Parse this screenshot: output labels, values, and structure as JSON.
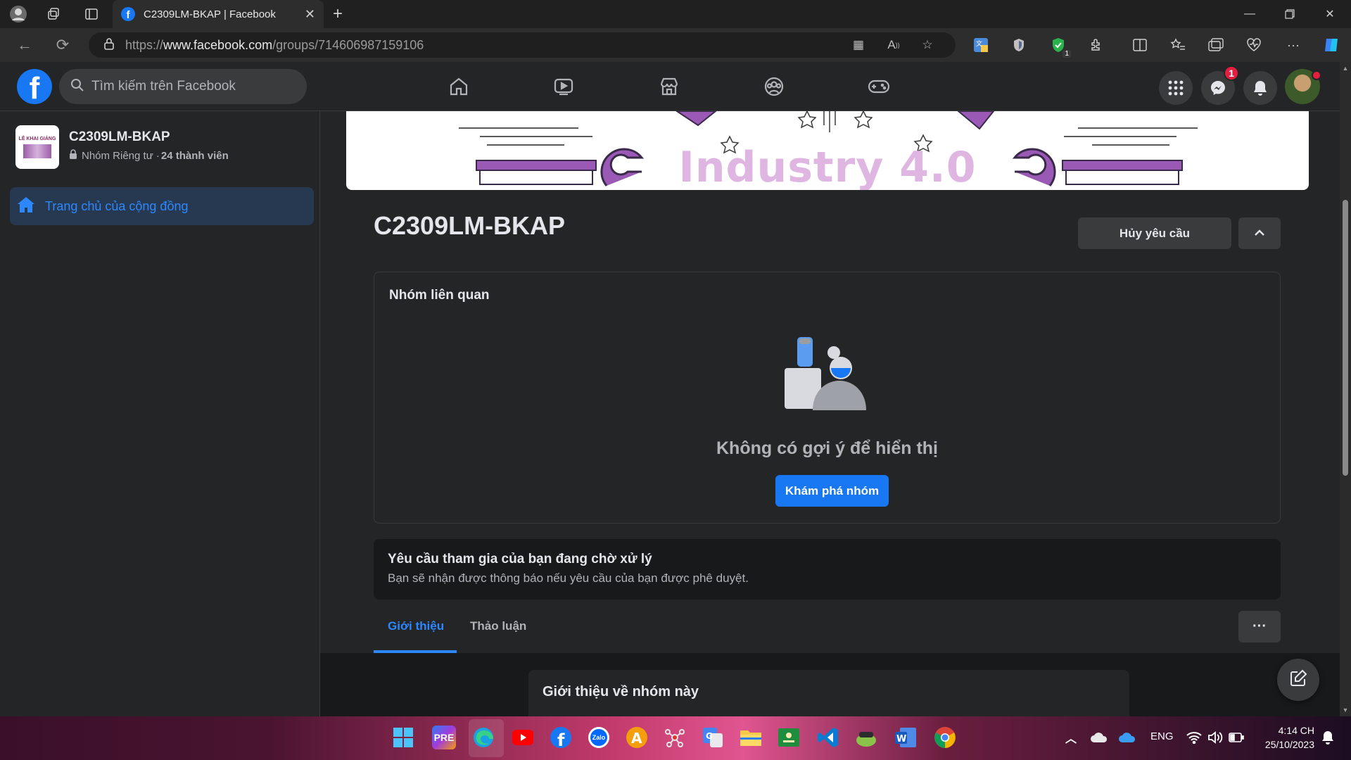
{
  "browser": {
    "tab_title": "C2309LM-BKAP | Facebook",
    "url_prefix": "https://",
    "url_domain": "www.facebook.com",
    "url_path": "/groups/714606987159106",
    "extension_badge": "1"
  },
  "facebook": {
    "logo": "f",
    "search_placeholder": "Tìm kiếm trên Facebook",
    "messenger_badge": "1"
  },
  "sidebar": {
    "group_name": "C2309LM-BKAP",
    "group_meta": "Nhóm Riêng tư · ",
    "member_count": "24 thành viên",
    "thumb_text": "LỄ KHAI GIẢNG",
    "nav_item": "Trang chủ của cộng đồng"
  },
  "main": {
    "cover_text": "Industry 4.0",
    "group_title": "C2309LM-BKAP",
    "cancel_request": "Hủy yêu cầu",
    "related_title": "Nhóm liên quan",
    "empty_text": "Không có gợi ý để hiển thị",
    "explore_button": "Khám phá nhóm",
    "pending_title": "Yêu cầu tham gia của bạn đang chờ xử lý",
    "pending_desc": "Bạn sẽ nhận được thông báo nếu yêu cầu của bạn được phê duyệt.",
    "tabs": [
      {
        "label": "Giới thiệu",
        "active": true
      },
      {
        "label": "Thảo luận",
        "active": false
      }
    ],
    "more_button": "···",
    "about_title": "Giới thiệu về nhóm này"
  },
  "taskbar": {
    "lang": "ENG",
    "time": "4:14 CH",
    "date": "25/10/2023",
    "zalo_label": "Zalo"
  },
  "colors": {
    "accent": "#1877f2",
    "link_blue": "#2d88ff",
    "badge_red": "#e41e3f",
    "surface": "#242526",
    "background": "#18191a"
  }
}
